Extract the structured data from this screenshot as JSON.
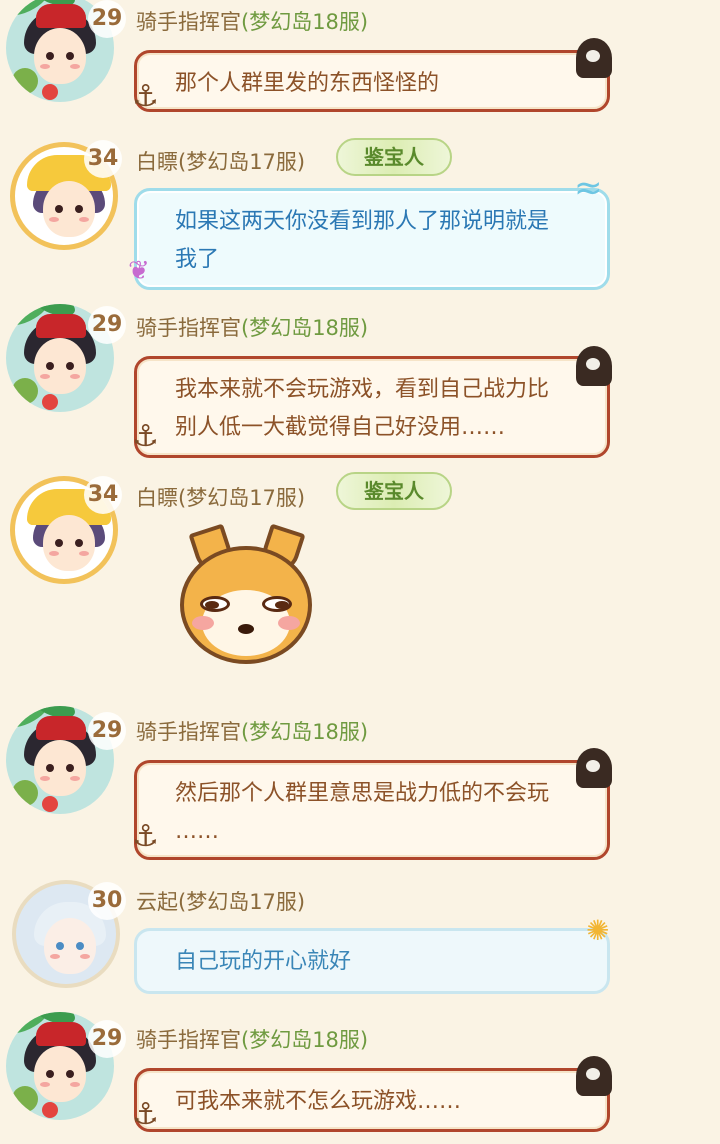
{
  "users": {
    "rider": {
      "level": "29",
      "name": "骑手指挥官",
      "server": "(梦幻岛18服)"
    },
    "baipiao": {
      "level": "34",
      "name": "白瞟",
      "server": "(梦幻岛17服)",
      "badge": "鉴宝人"
    },
    "yunqi": {
      "level": "30",
      "name": "云起",
      "server": "(梦幻岛17服)"
    }
  },
  "messages": [
    {
      "sender": "rider",
      "lines": [
        "那个人群里发的东西怪怪的"
      ]
    },
    {
      "sender": "baipiao",
      "lines": [
        "如果这两天你没看到那人了那说明就是",
        "我了"
      ]
    },
    {
      "sender": "rider",
      "lines": [
        "我本来就不会玩游戏，看到自己战力比",
        "别人低一大截觉得自己好没用……"
      ]
    },
    {
      "sender": "baipiao",
      "sticker": "dog-face-sticker"
    },
    {
      "sender": "rider",
      "lines": [
        "然后那个人群里意思是战力低的不会玩",
        "……"
      ]
    },
    {
      "sender": "yunqi",
      "lines": [
        "自己玩的开心就好"
      ]
    },
    {
      "sender": "rider",
      "lines": [
        "可我本来就不怎么玩游戏……"
      ]
    }
  ],
  "colors": {
    "background": "#faf3e4",
    "name": "#8a6a3c",
    "server": "#6f9a40",
    "pirate_text": "#8c5228",
    "sea_text": "#2b78b4"
  }
}
